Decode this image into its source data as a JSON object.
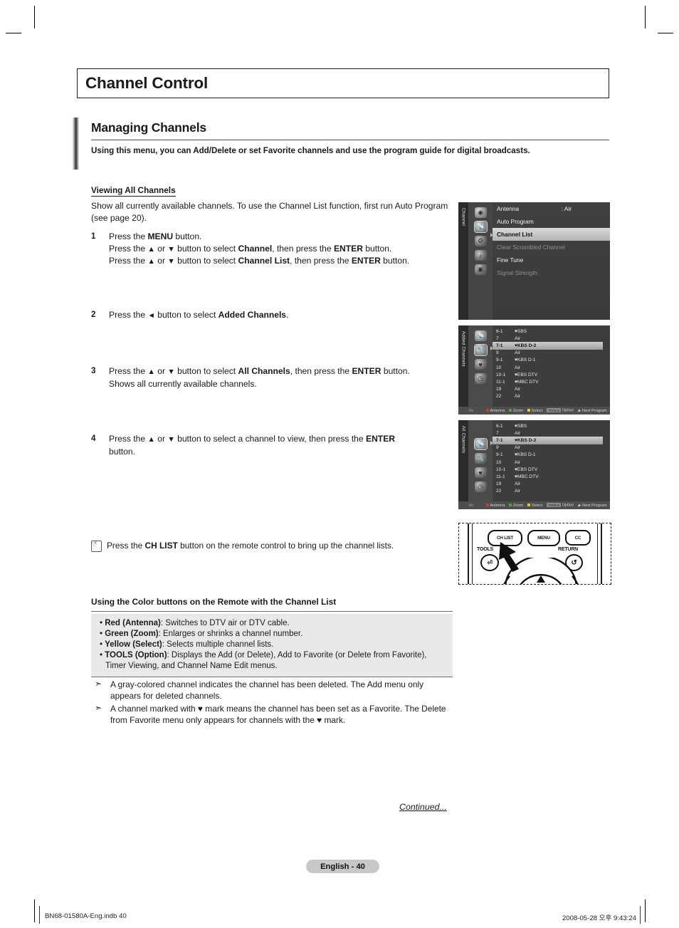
{
  "page": {
    "title": "Channel Control",
    "section_title": "Managing Channels",
    "section_subtitle": "Using this menu, you can Add/Delete or set Favorite channels and use the program guide for digital broadcasts.",
    "sub_heading": "Viewing All Channels",
    "intro": "Show all currently available channels. To use the Channel List function, first run Auto Program (see page 20).",
    "continued": "Continued...",
    "page_badge": "English - 40"
  },
  "steps": [
    {
      "num": "1",
      "lines": [
        "Press the MENU button.",
        "Press the ▲ or ▼ button to select Channel, then press the ENTER button.",
        "Press the ▲ or ▼ button to select Channel List, then press the ENTER button."
      ]
    },
    {
      "num": "2",
      "lines": [
        "Press the ◄ button to select Added Channels."
      ]
    },
    {
      "num": "3",
      "lines": [
        "Press the ▲ or ▼ button to select All Channels, then press the ENTER button.",
        "Shows all currently available channels."
      ]
    },
    {
      "num": "4",
      "lines": [
        "Press the ▲ or ▼ button to select a channel to view, then press the ENTER button."
      ]
    }
  ],
  "note": "Press the CH LIST button on the remote control to bring up the channel lists.",
  "color_buttons": {
    "heading": "Using the Color buttons on the Remote with the Channel List",
    "items": [
      {
        "label": "Red (Antenna)",
        "text": ": Switches to DTV air or DTV cable."
      },
      {
        "label": "Green (Zoom)",
        "text": ": Enlarges or shrinks a channel number."
      },
      {
        "label": "Yellow (Select)",
        "text": ": Selects multiple channel lists."
      },
      {
        "label": "TOOLS (Option)",
        "text": ": Displays the Add (or Delete), Add to Favorite (or Delete from Favorite), Timer Viewing, and Channel Name Edit menus."
      }
    ]
  },
  "notes": [
    "A gray-colored channel indicates the channel has been deleted. The Add menu only appears for deleted channels.",
    "A channel marked with ♥ mark means the channel has been set as a Favorite. The Delete from Favorite menu only appears for channels with the ♥ mark."
  ],
  "osd_menu": {
    "tab_label": "Channel",
    "rows": [
      {
        "label": "Antenna",
        "value": ": Air",
        "state": "normal"
      },
      {
        "label": "Auto Program",
        "value": "",
        "state": "normal"
      },
      {
        "label": "Channel List",
        "value": "",
        "state": "highlighted"
      },
      {
        "label": "Clear Scrambled Channel",
        "value": "",
        "state": "dim"
      },
      {
        "label": "Fine Tune",
        "value": "",
        "state": "normal"
      },
      {
        "label": "Signal Strength",
        "value": "",
        "state": "dim"
      }
    ],
    "rail_icons": [
      "picture-icon",
      "antenna-icon",
      "setup-icon",
      "sound-icon",
      "input-icon"
    ]
  },
  "osd_added": {
    "tab_label": "Added Channels",
    "rail_icons": [
      "antenna-icon",
      "tools-icon",
      "favorite-icon",
      "timer-icon"
    ],
    "channels": [
      {
        "num": "6-1",
        "fav": "♥",
        "name": "SBS",
        "sel": false
      },
      {
        "num": "7",
        "fav": "",
        "name": "Air",
        "sel": false
      },
      {
        "num": "7-1",
        "fav": "♥",
        "name": "KBS D-2",
        "sel": true
      },
      {
        "num": "9",
        "fav": "",
        "name": "Air",
        "sel": false
      },
      {
        "num": "9-1",
        "fav": "♥",
        "name": "KBS D-1",
        "sel": false
      },
      {
        "num": "10",
        "fav": "",
        "name": "Air",
        "sel": false
      },
      {
        "num": "10-1",
        "fav": "♥",
        "name": "EBS DTV",
        "sel": false
      },
      {
        "num": "11-1",
        "fav": "♥",
        "name": "MBC DTV",
        "sel": false
      },
      {
        "num": "19",
        "fav": "",
        "name": "Air",
        "sel": false
      },
      {
        "num": "22",
        "fav": "",
        "name": "Air",
        "sel": false
      }
    ],
    "status": {
      "air": "Air",
      "antenna": "Antenna",
      "zoom": "Zoom",
      "select": "Select",
      "tools": "TOOLS",
      "option": "Option",
      "next": "Next Program"
    }
  },
  "osd_all": {
    "tab_label": "All Channels",
    "rail_icons": [
      "antenna-icon",
      "tools-icon",
      "favorite-icon",
      "timer-icon"
    ],
    "channels": [
      {
        "num": "6-1",
        "fav": "♥",
        "name": "SBS",
        "sel": false
      },
      {
        "num": "7",
        "fav": "",
        "name": "Air",
        "sel": false
      },
      {
        "num": "7-1",
        "fav": "♥",
        "name": "KBS D-2",
        "sel": true
      },
      {
        "num": "9",
        "fav": "",
        "name": "Air",
        "sel": false
      },
      {
        "num": "9-1",
        "fav": "♥",
        "name": "KBS D-1",
        "sel": false
      },
      {
        "num": "10",
        "fav": "",
        "name": "Air",
        "sel": false
      },
      {
        "num": "10-1",
        "fav": "♥",
        "name": "EBS DTV",
        "sel": false
      },
      {
        "num": "11-1",
        "fav": "♥",
        "name": "MBC DTV",
        "sel": false
      },
      {
        "num": "19",
        "fav": "",
        "name": "Air",
        "sel": false
      },
      {
        "num": "22",
        "fav": "",
        "name": "Air",
        "sel": false
      }
    ],
    "status": {
      "air": "Air",
      "antenna": "Antenna",
      "zoom": "Zoom",
      "select": "Select",
      "tools": "TOOLS",
      "option": "Option",
      "next": "Next Program"
    }
  },
  "remote": {
    "buttons": [
      "CH LIST",
      "MENU",
      "CC"
    ],
    "labels": [
      "TOOLS",
      "RETURN"
    ]
  },
  "footer": {
    "left": "BN68-01580A-Eng.indb   40",
    "right": "2008-05-28   오후 9:43:24"
  },
  "colors": {
    "highlight": "#c8c8c8",
    "red": "#d03b34",
    "green": "#4fa44a",
    "yellow": "#d8c63d"
  }
}
